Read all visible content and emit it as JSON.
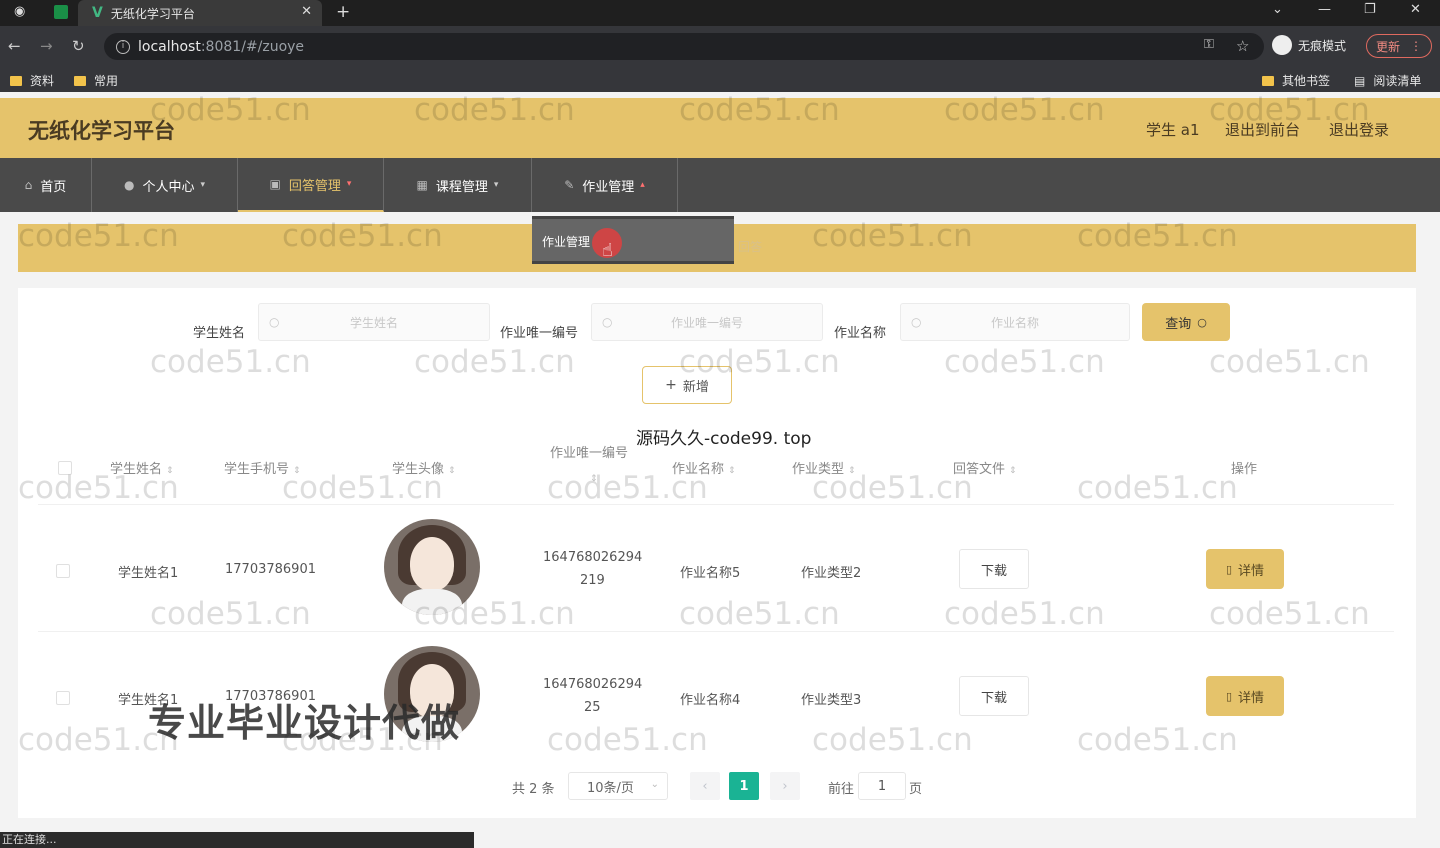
{
  "browser": {
    "tab_title": "无纸化学习平台",
    "url_host": "localhost",
    "url_rest": ":8081/#/zuoye",
    "incognito_label": "无痕模式",
    "update_label": "更新",
    "bookmarks": [
      "资料",
      "常用",
      "其他书签",
      "阅读清单"
    ],
    "status_text": "正在连接..."
  },
  "header": {
    "title": "无纸化学习平台",
    "user": "学生 a1",
    "to_front": "退出到前台",
    "logout": "退出登录"
  },
  "nav": {
    "items": [
      {
        "label": "首页",
        "icon": "home-icon"
      },
      {
        "label": "个人中心",
        "icon": "user-icon"
      },
      {
        "label": "回答管理",
        "icon": "clipboard-icon"
      },
      {
        "label": "课程管理",
        "icon": "grid-icon"
      },
      {
        "label": "作业管理",
        "icon": "edit-icon"
      }
    ],
    "dropdown_item": "作业管理",
    "behind_text": "回答"
  },
  "filters": {
    "student_name_label": "学生姓名",
    "student_name_placeholder": "学生姓名",
    "homework_id_label": "作业唯一编号",
    "homework_id_placeholder": "作业唯一编号",
    "homework_name_label": "作业名称",
    "homework_name_placeholder": "作业名称",
    "search_label": "查询",
    "add_label": "新增"
  },
  "table": {
    "headers": [
      "学生姓名",
      "学生手机号",
      "学生头像",
      "作业唯一编号",
      "作业名称",
      "作业类型",
      "回答文件",
      "操作"
    ],
    "rows": [
      {
        "name": "学生姓名1",
        "phone": "17703786901",
        "id_line1": "164768026294",
        "id_line2": "219",
        "hw_name": "作业名称5",
        "hw_type": "作业类型2",
        "download": "下载",
        "detail": "详情"
      },
      {
        "name": "学生姓名1",
        "phone": "17703786901",
        "id_line1": "164768026294",
        "id_line2": "25",
        "hw_name": "作业名称4",
        "hw_type": "作业类型3",
        "download": "下载",
        "detail": "详情"
      }
    ]
  },
  "pagination": {
    "total": "共 2 条",
    "page_size": "10条/页",
    "current": "1",
    "goto_label": "前往",
    "goto_value": "1",
    "page_label": "页"
  },
  "overlay": {
    "watermark": "code51.cn",
    "source_text": "源码久久-code99. top",
    "big_text": "专业毕业设计代做"
  },
  "colors": {
    "accent": "#e5c36b",
    "nav_bg": "#4a4a4a",
    "page_active": "#1ab394"
  }
}
